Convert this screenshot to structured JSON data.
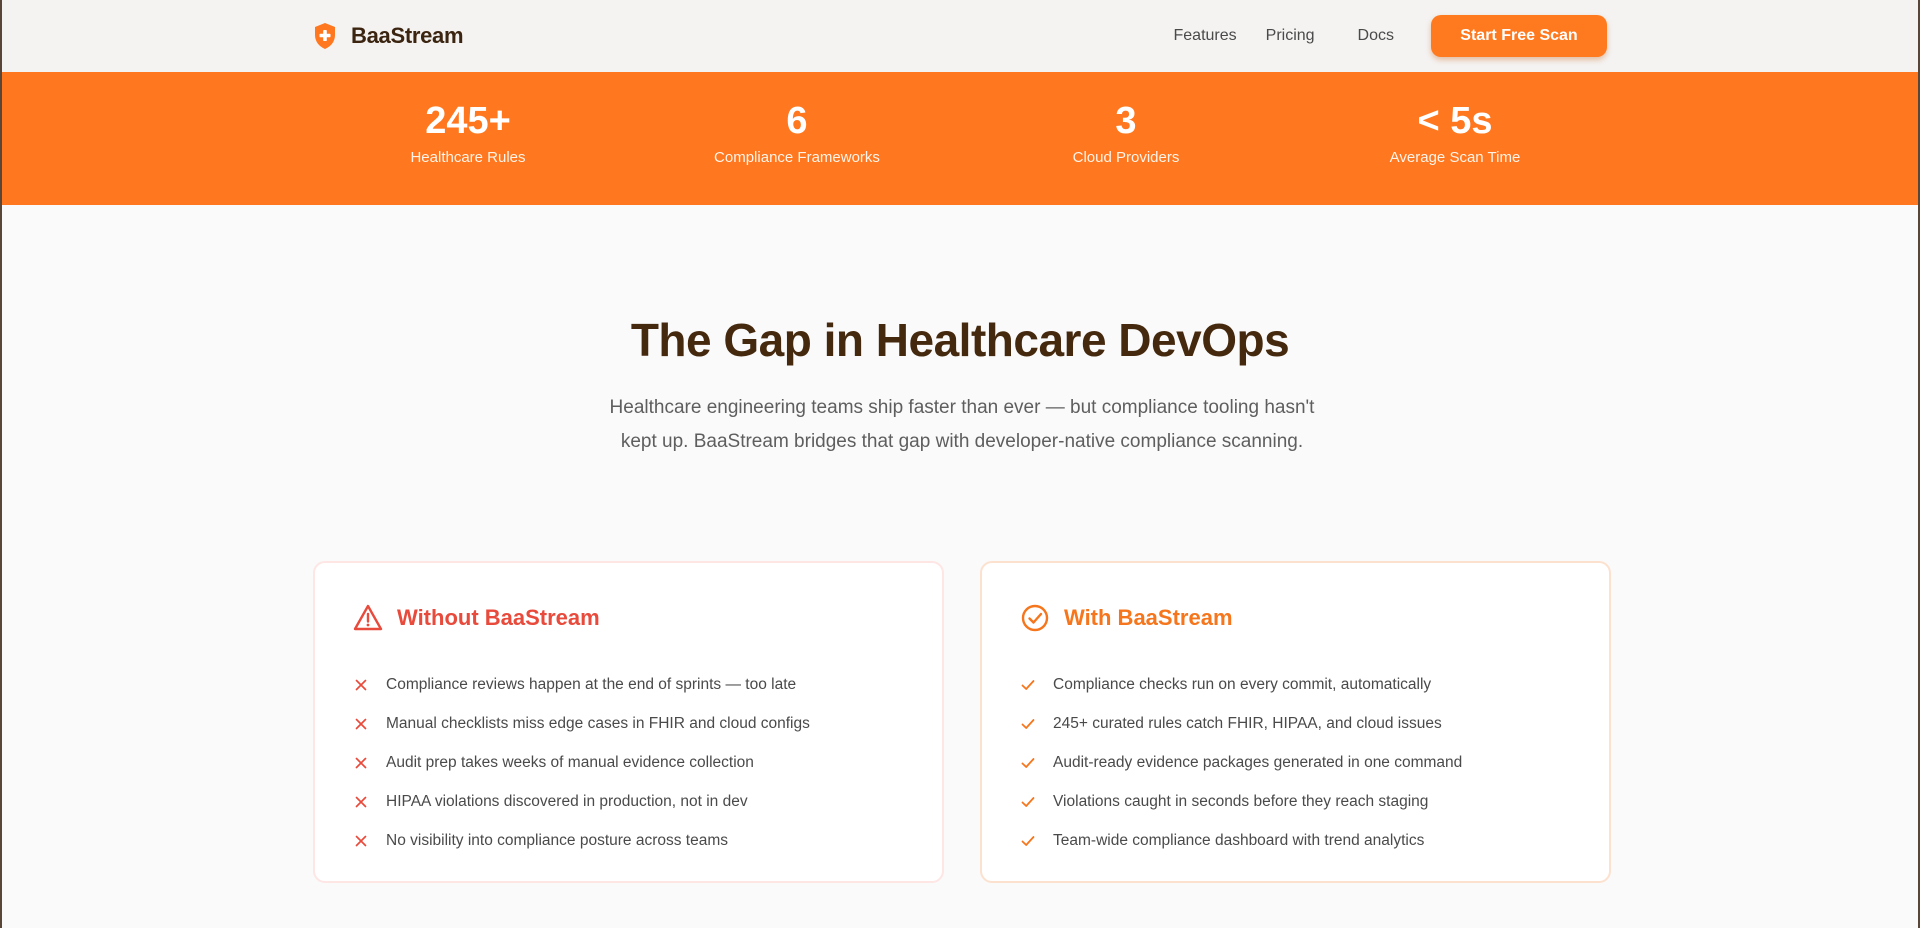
{
  "nav": {
    "brand": "BaaStream",
    "links": [
      "Features",
      "Pricing",
      "Docs"
    ],
    "cta_label": "Start Free Scan"
  },
  "stats": [
    {
      "value": "245+",
      "label": "Healthcare Rules"
    },
    {
      "value": "6",
      "label": "Compliance Frameworks"
    },
    {
      "value": "3",
      "label": "Cloud Providers"
    },
    {
      "value": "< 5s",
      "label": "Average Scan Time"
    }
  ],
  "hero": {
    "title": "The Gap in Healthcare DevOps",
    "subtitle": "Healthcare engineering teams ship faster than ever — but compliance tooling hasn't kept up. BaaStream bridges that gap with developer-native compliance scanning."
  },
  "without": {
    "title": "Without BaaStream",
    "icon": "warning-triangle-icon",
    "items": [
      "Compliance reviews happen at the end of sprints — too late",
      "Manual checklists miss edge cases in FHIR and cloud configs",
      "Audit prep takes weeks of manual evidence collection",
      "HIPAA violations discovered in production, not in dev",
      "No visibility into compliance posture across teams"
    ]
  },
  "with": {
    "title": "With BaaStream",
    "icon": "check-circle-icon",
    "items": [
      "Compliance checks run on every commit, automatically",
      "245+ curated rules catch FHIR, HIPAA, and cloud issues",
      "Audit-ready evidence packages generated in one command",
      "Violations caught in seconds before they reach staging",
      "Team-wide compliance dashboard with trend analytics"
    ]
  },
  "colors": {
    "accent": "#ff771e",
    "danger": "#e84a3b",
    "heading": "#45290f"
  }
}
